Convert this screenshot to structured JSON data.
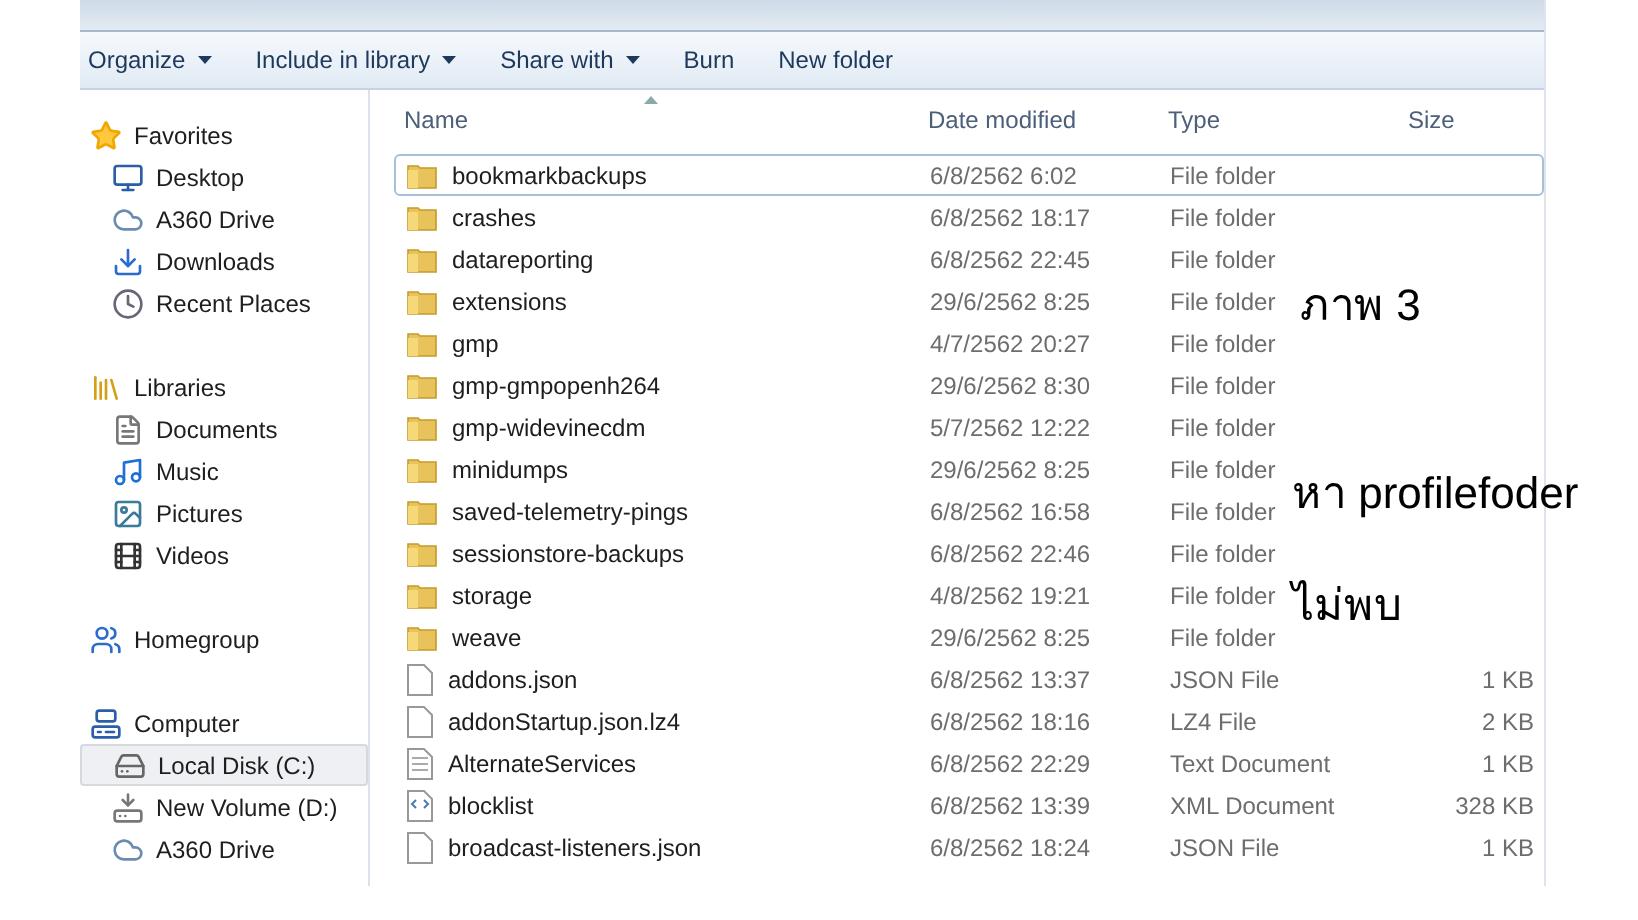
{
  "toolbar": [
    {
      "label": "Organize",
      "dropdown": true
    },
    {
      "label": "Include in library",
      "dropdown": true
    },
    {
      "label": "Share with",
      "dropdown": true
    },
    {
      "label": "Burn",
      "dropdown": false
    },
    {
      "label": "New folder",
      "dropdown": false
    }
  ],
  "sidebar": [
    {
      "label": "Favorites",
      "kind": "star",
      "children": [
        {
          "label": "Desktop",
          "kind": "desktop",
          "selected": false
        },
        {
          "label": "A360 Drive",
          "kind": "cloud",
          "selected": false
        },
        {
          "label": "Downloads",
          "kind": "download",
          "selected": false
        },
        {
          "label": "Recent Places",
          "kind": "recent",
          "selected": false
        }
      ]
    },
    {
      "label": "Libraries",
      "kind": "library",
      "children": [
        {
          "label": "Documents",
          "kind": "document",
          "selected": false
        },
        {
          "label": "Music",
          "kind": "music",
          "selected": false
        },
        {
          "label": "Pictures",
          "kind": "picture",
          "selected": false
        },
        {
          "label": "Videos",
          "kind": "video",
          "selected": false
        }
      ]
    },
    {
      "label": "Homegroup",
      "kind": "homegroup"
    },
    {
      "label": "Computer",
      "kind": "computer",
      "children": [
        {
          "label": "Local Disk (C:)",
          "kind": "disk",
          "selected": true
        },
        {
          "label": "New Volume (D:)",
          "kind": "drive",
          "selected": false
        },
        {
          "label": "A360 Drive",
          "kind": "cloud",
          "selected": false
        }
      ]
    }
  ],
  "table": {
    "columns": [
      "Name",
      "Date modified",
      "Type",
      "Size"
    ],
    "rows": [
      {
        "name": "bookmarkbackups",
        "date": "6/8/2562 6:02",
        "type": "File folder",
        "kind": "folder",
        "selected": true
      },
      {
        "name": "crashes",
        "date": "6/8/2562 18:17",
        "type": "File folder",
        "kind": "folder",
        "selected": false
      },
      {
        "name": "datareporting",
        "date": "6/8/2562 22:45",
        "type": "File folder",
        "kind": "folder",
        "selected": false
      },
      {
        "name": "extensions",
        "date": "29/6/2562 8:25",
        "type": "File folder",
        "kind": "folder",
        "selected": false
      },
      {
        "name": "gmp",
        "date": "4/7/2562 20:27",
        "type": "File folder",
        "kind": "folder",
        "selected": false
      },
      {
        "name": "gmp-gmpopenh264",
        "date": "29/6/2562 8:30",
        "type": "File folder",
        "kind": "folder",
        "selected": false
      },
      {
        "name": "gmp-widevinecdm",
        "date": "5/7/2562 12:22",
        "type": "File folder",
        "kind": "folder",
        "selected": false
      },
      {
        "name": "minidumps",
        "date": "29/6/2562 8:25",
        "type": "File folder",
        "kind": "folder",
        "selected": false
      },
      {
        "name": "saved-telemetry-pings",
        "date": "6/8/2562 16:58",
        "type": "File folder",
        "kind": "folder",
        "selected": false
      },
      {
        "name": "sessionstore-backups",
        "date": "6/8/2562 22:46",
        "type": "File folder",
        "kind": "folder",
        "selected": false
      },
      {
        "name": "storage",
        "date": "4/8/2562 19:21",
        "type": "File folder",
        "kind": "folder",
        "selected": false
      },
      {
        "name": "weave",
        "date": "29/6/2562 8:25",
        "type": "File folder",
        "kind": "folder",
        "selected": false
      },
      {
        "name": "addons.json",
        "date": "6/8/2562 13:37",
        "type": "JSON File",
        "size": "1 KB",
        "kind": "file",
        "selected": false
      },
      {
        "name": "addonStartup.json.lz4",
        "date": "6/8/2562 18:16",
        "type": "LZ4 File",
        "size": "2 KB",
        "kind": "file",
        "selected": false
      },
      {
        "name": "AlternateServices",
        "date": "6/8/2562 22:29",
        "type": "Text Document",
        "size": "1 KB",
        "kind": "text",
        "selected": false
      },
      {
        "name": "blocklist",
        "date": "6/8/2562 13:39",
        "type": "XML Document",
        "size": "328 KB",
        "kind": "xml",
        "selected": false
      },
      {
        "name": "broadcast-listeners.json",
        "date": "6/8/2562 18:24",
        "type": "JSON File",
        "size": "1 KB",
        "kind": "file",
        "selected": false
      }
    ]
  },
  "annotations": [
    {
      "text": "ภาพ  3",
      "kind": "caption"
    },
    {
      "text": "หา profilefoder",
      "kind": "note"
    },
    {
      "text": "ไม่พบ",
      "kind": "note2"
    }
  ]
}
